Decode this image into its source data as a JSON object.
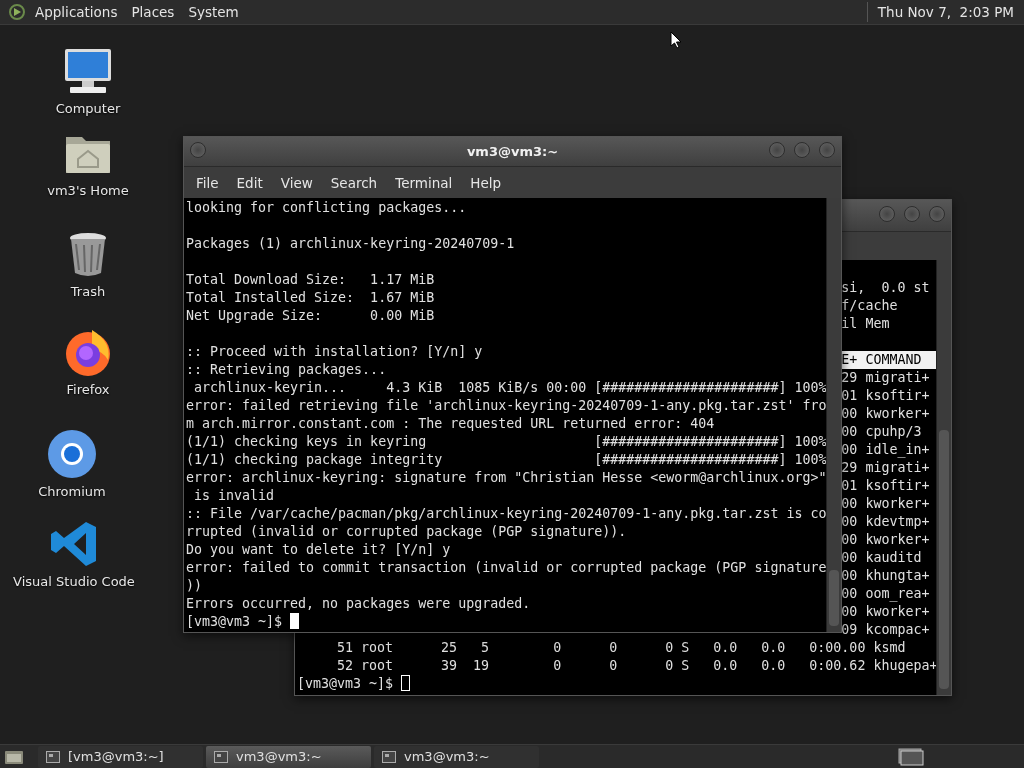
{
  "top_panel": {
    "menus": [
      "Applications",
      "Places",
      "System"
    ],
    "clock": "Thu Nov 7,  2:03 PM"
  },
  "desktop_icons": [
    {
      "label": "Computer",
      "kind": "computer"
    },
    {
      "label": "vm3's Home",
      "kind": "home"
    },
    {
      "label": "Trash",
      "kind": "trash"
    },
    {
      "label": "Firefox",
      "kind": "firefox"
    },
    {
      "label": "Chromium",
      "kind": "chromium"
    },
    {
      "label": "Visual Studio Code",
      "kind": "vscode"
    }
  ],
  "background_terminal": {
    "peek_lines": [
      {
        "text": "si,  0.0 st",
        "kind": "plain"
      },
      {
        "text": "f/cache",
        "kind": "plain"
      },
      {
        "text": "il Mem",
        "kind": "plain"
      },
      {
        "text": "E+ COMMAND",
        "kind": "header"
      },
      {
        "text": "29 migrati+",
        "kind": "plain"
      },
      {
        "text": "01 ksoftir+",
        "kind": "plain"
      },
      {
        "text": "00 kworker+",
        "kind": "plain"
      },
      {
        "text": "00 cpuhp/3",
        "kind": "plain"
      },
      {
        "text": "00 idle_in+",
        "kind": "plain"
      },
      {
        "text": "29 migrati+",
        "kind": "plain"
      },
      {
        "text": "01 ksoftir+",
        "kind": "plain"
      },
      {
        "text": "00 kworker+",
        "kind": "plain"
      },
      {
        "text": "00 kdevtmp+",
        "kind": "plain"
      },
      {
        "text": "00 kworker+",
        "kind": "plain"
      },
      {
        "text": "00 kauditd",
        "kind": "plain"
      },
      {
        "text": "00 khungta+",
        "kind": "plain"
      },
      {
        "text": "00 oom_rea+",
        "kind": "plain"
      },
      {
        "text": "00 kworker+",
        "kind": "plain"
      },
      {
        "text": "09 kcompac+",
        "kind": "plain"
      }
    ],
    "rows": [
      "     51 root      25   5        0      0      0 S   0.0   0.0   0:00.00 ksmd",
      "     52 root      39  19        0      0      0 S   0.0   0.0   0:00.62 khugepa+"
    ],
    "prompt": "[vm3@vm3 ~]$",
    "focused": false
  },
  "terminal": {
    "title": "vm3@vm3:~",
    "menu": [
      "File",
      "Edit",
      "View",
      "Search",
      "Terminal",
      "Help"
    ],
    "blocks": [
      [
        "looking for conflicting packages..."
      ],
      [
        "Packages (1) archlinux-keyring-20240709-1"
      ],
      [
        "Total Download Size:   1.17 MiB",
        "Total Installed Size:  1.67 MiB",
        "Net Upgrade Size:      0.00 MiB"
      ],
      [
        ":: Proceed with installation? [Y/n] y",
        ":: Retrieving packages...",
        " archlinux-keyrin...     4.3 KiB  1085 KiB/s 00:00 [######################] 100%",
        "error: failed retrieving file 'archlinux-keyring-20240709-1-any.pkg.tar.zst' fro",
        "m arch.mirror.constant.com : The requested URL returned error: 404",
        "(1/1) checking keys in keyring                     [######################] 100%",
        "(1/1) checking package integrity                   [######################] 100%",
        "error: archlinux-keyring: signature from \"Christian Hesse <eworm@archlinux.org>\"",
        " is invalid",
        ":: File /var/cache/pacman/pkg/archlinux-keyring-20240709-1-any.pkg.tar.zst is co",
        "rrupted (invalid or corrupted package (PGP signature)).",
        "Do you want to delete it? [Y/n] y",
        "error: failed to commit transaction (invalid or corrupted package (PGP signature",
        "))",
        "Errors occurred, no packages were upgraded."
      ]
    ],
    "prompt": "[vm3@vm3 ~]$",
    "focused": true
  },
  "taskbar": {
    "items": [
      {
        "label": "[vm3@vm3:~]",
        "selected": false
      },
      {
        "label": "vm3@vm3:~",
        "selected": true
      },
      {
        "label": "vm3@vm3:~",
        "selected": false
      }
    ]
  }
}
